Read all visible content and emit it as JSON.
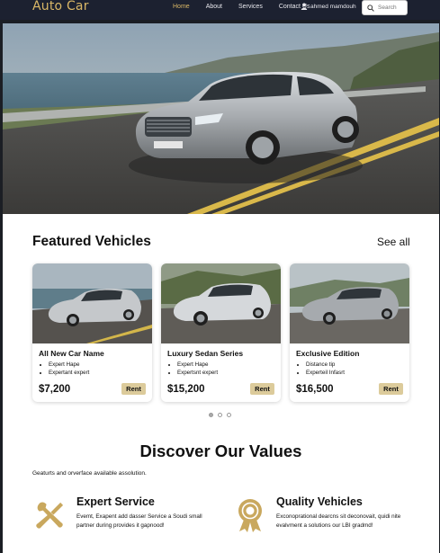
{
  "header": {
    "brand": "Auto Car",
    "nav": [
      "Home",
      "About",
      "Services",
      "Contact Us"
    ],
    "user_name": "ahmed mamdouh",
    "search_placeholder": "Search",
    "accent_color": "#d9b766"
  },
  "featured": {
    "title": "Featured Vehicles",
    "see_all": "See all",
    "cards": [
      {
        "title": "All New Car Name",
        "features": [
          "Expert Hape",
          "Expertant expert"
        ],
        "price": "$7,200",
        "button": "Rent"
      },
      {
        "title": "Luxury Sedan Series",
        "features": [
          "Expert Hape",
          "Expertsnt expert"
        ],
        "price": "$15,200",
        "button": "Rent"
      },
      {
        "title": "Exclusive Edition",
        "features": [
          "Distance tip",
          "Experteil Infasrt"
        ],
        "price": "$16,500",
        "button": "Rent"
      }
    ],
    "carousel_active": 1
  },
  "values": {
    "title": "Discover Our Values",
    "subtitle": "Geaturts and orverface available assolution.",
    "items": [
      {
        "icon": "tools-icon",
        "title": "Expert Service",
        "desc": "Evemt, Exapent add dasser Service a Soudi small partner during provides it gapnood!"
      },
      {
        "icon": "award-badge-icon",
        "title": "Quality Vehicles",
        "desc": "Exconoprational dearcns sit deconovait, quidi nite evalvment a solutions our LBI gradmd!"
      }
    ]
  }
}
